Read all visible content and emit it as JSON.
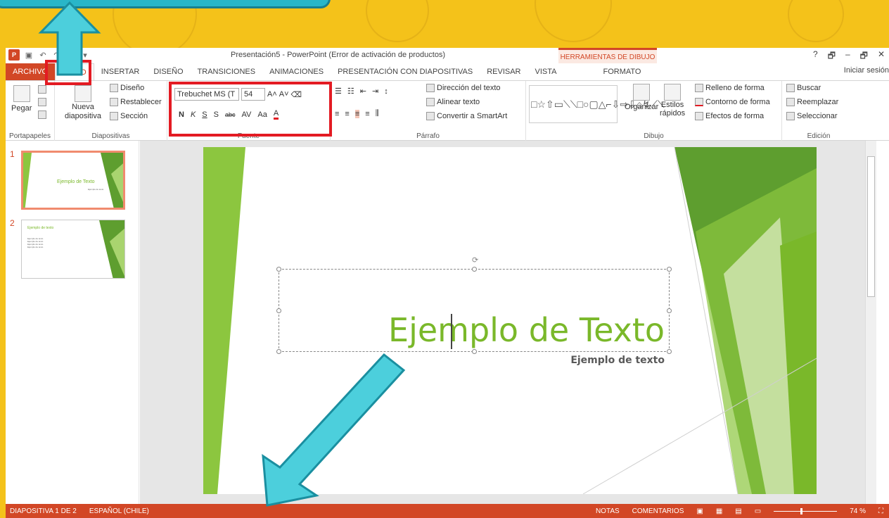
{
  "window": {
    "title": "Presentación5 - PowerPoint (Error de activación de productos)",
    "context_title": "HERRAMIENTAS DE DIBUJO",
    "signin": "Iniciar sesión",
    "help": "?",
    "minimize": "–",
    "maximize": "🗗",
    "close": "✕"
  },
  "tabs": [
    "ARCHIVO",
    "INICIO",
    "INSERTAR",
    "DISEÑO",
    "TRANSICIONES",
    "ANIMACIONES",
    "PRESENTACIÓN CON DIAPOSITIVAS",
    "REVISAR",
    "VISTA",
    "FORMATO"
  ],
  "active_tab": "INICIO",
  "ribbon": {
    "portapapeles": {
      "label": "Portapapeles",
      "paste": "Pegar"
    },
    "diapositivas": {
      "label": "Diapositivas",
      "new": "Nueva",
      "new2": "diapositiva",
      "design": "Diseño",
      "reset": "Restablecer",
      "section": "Sección"
    },
    "fuente": {
      "label": "Fuente",
      "font": "Trebuchet MS (T",
      "size": "54",
      "bold": "N",
      "italic": "K",
      "underline": "S",
      "shadow": "S",
      "strike": "abc",
      "spacing": "AV",
      "case": "Aa",
      "color": "A"
    },
    "parrafo": {
      "label": "Párrafo",
      "direction": "Dirección del texto",
      "align": "Alinear texto",
      "smartart": "Convertir a SmartArt"
    },
    "dibujo": {
      "label": "Dibujo",
      "arrange": "Organizar",
      "styles": "Estilos",
      "styles2": "rápidos",
      "fill": "Relleno de forma",
      "outline": "Contorno de forma",
      "effects": "Efectos de forma"
    },
    "edicion": {
      "label": "Edición",
      "find": "Buscar",
      "replace": "Reemplazar",
      "select": "Seleccionar"
    }
  },
  "thumbnails": [
    {
      "num": "1",
      "title": "Ejemplo de Texto",
      "sub": "Ejemplo de texto"
    },
    {
      "num": "2",
      "title": "Ejemplo de texto",
      "lines": [
        "Ejemplo de texto",
        "Ejemplo de texto",
        "Ejemplo de texto",
        "Ejemplo de texto"
      ]
    }
  ],
  "slide": {
    "title": "Ejemplo de Texto",
    "subtitle": "Ejemplo de texto"
  },
  "status": {
    "slide_info": "DIAPOSITIVA 1 DE 2",
    "language": "ESPAÑOL (CHILE)",
    "notes": "NOTAS",
    "comments": "COMENTARIOS",
    "zoom": "74 %"
  },
  "colors": {
    "accent": "#d24726",
    "slide_green": "#7ab82a",
    "background": "#f4c21a",
    "arrow": "#4ccfdc",
    "highlight": "#e31b23"
  }
}
